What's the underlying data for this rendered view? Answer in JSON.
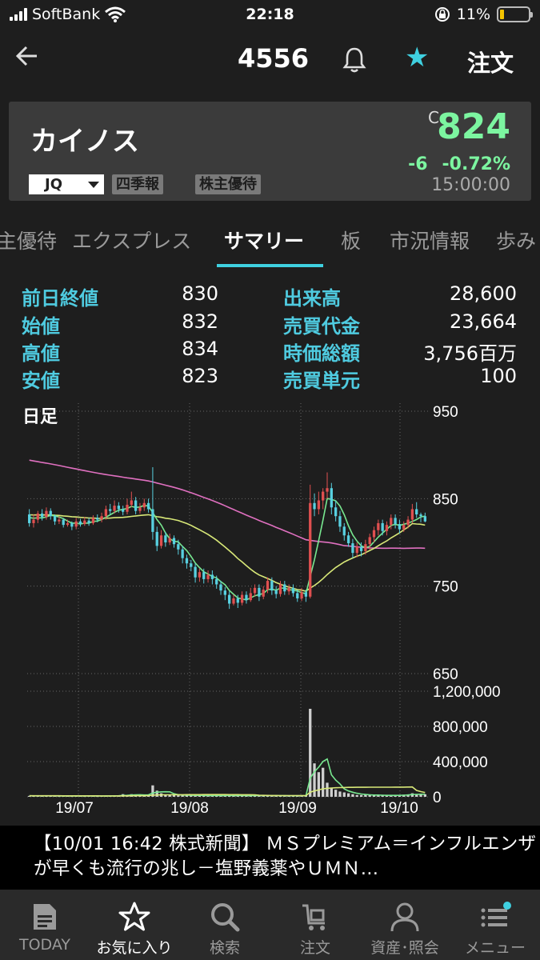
{
  "status": {
    "carrier": "SoftBank",
    "time": "22:18",
    "battery": "11%"
  },
  "nav": {
    "code": "4556",
    "order_label": "注文"
  },
  "quote": {
    "name": "カイノス",
    "price_flag": "C",
    "price": "824",
    "change": "-6",
    "change_pct": "-0.72%",
    "time": "15:00:00",
    "market": "JQ",
    "tags": [
      "四季報",
      "株主優待"
    ]
  },
  "tabs": [
    "主優待",
    "エクスプレス",
    "サマリー",
    "板",
    "市況情報",
    "歩み"
  ],
  "summary": [
    {
      "k1": "前日終値",
      "v1": "830",
      "k2": "出来高",
      "v2": "28,600"
    },
    {
      "k1": "始値",
      "v1": "832",
      "k2": "売買代金",
      "v2": "23,664"
    },
    {
      "k1": "高値",
      "v1": "834",
      "k2": "時価総額",
      "v2": "3,756百万"
    },
    {
      "k1": "安値",
      "v1": "823",
      "k2": "売買単元",
      "v2": "100"
    }
  ],
  "chart_data": {
    "type": "candlestick",
    "label": "日足",
    "price_axis": {
      "ticks": [
        "950",
        "850",
        "750",
        "650"
      ],
      "range": [
        650,
        950
      ]
    },
    "volume_axis": {
      "ticks": [
        "1,200,000",
        "800,000",
        "400,000",
        "0"
      ],
      "range": [
        0,
        1200000
      ]
    },
    "x_labels": [
      "19/07",
      "19/08",
      "19/09",
      "19/10"
    ],
    "candles": [
      [
        832,
        822,
        838,
        818
      ],
      [
        822,
        826,
        832,
        817
      ],
      [
        826,
        833,
        836,
        822
      ],
      [
        833,
        829,
        838,
        825
      ],
      [
        829,
        836,
        840,
        826
      ],
      [
        836,
        830,
        839,
        826
      ],
      [
        830,
        824,
        832,
        820
      ],
      [
        824,
        826,
        830,
        821
      ],
      [
        826,
        820,
        828,
        817
      ],
      [
        820,
        822,
        826,
        818
      ],
      [
        822,
        818,
        824,
        814
      ],
      [
        818,
        824,
        828,
        815
      ],
      [
        824,
        821,
        827,
        818
      ],
      [
        821,
        825,
        829,
        819
      ],
      [
        825,
        822,
        828,
        819
      ],
      [
        822,
        828,
        831,
        820
      ],
      [
        828,
        826,
        832,
        823
      ],
      [
        826,
        830,
        834,
        823
      ],
      [
        830,
        838,
        842,
        826
      ],
      [
        838,
        836,
        844,
        832
      ],
      [
        836,
        842,
        848,
        833
      ],
      [
        842,
        838,
        846,
        834
      ],
      [
        838,
        835,
        842,
        831
      ],
      [
        835,
        843,
        850,
        832
      ],
      [
        843,
        848,
        858,
        840
      ],
      [
        848,
        836,
        852,
        832
      ],
      [
        836,
        840,
        845,
        833
      ],
      [
        840,
        845,
        850,
        836
      ],
      [
        845,
        838,
        850,
        834
      ],
      [
        838,
        812,
        886,
        803
      ],
      [
        812,
        796,
        818,
        790
      ],
      [
        796,
        808,
        814,
        793
      ],
      [
        808,
        800,
        812,
        795
      ],
      [
        800,
        805,
        810,
        797
      ],
      [
        805,
        798,
        808,
        794
      ],
      [
        798,
        792,
        803,
        786
      ],
      [
        792,
        782,
        796,
        776
      ],
      [
        782,
        776,
        786,
        770
      ],
      [
        776,
        772,
        780,
        767
      ],
      [
        772,
        760,
        776,
        754
      ],
      [
        760,
        766,
        770,
        755
      ],
      [
        766,
        758,
        770,
        753
      ],
      [
        758,
        763,
        768,
        754
      ],
      [
        763,
        758,
        768,
        752
      ],
      [
        758,
        752,
        762,
        747
      ],
      [
        752,
        745,
        756,
        740
      ],
      [
        745,
        740,
        749,
        734
      ],
      [
        740,
        730,
        744,
        724
      ],
      [
        730,
        736,
        740,
        728
      ],
      [
        736,
        731,
        740,
        725
      ],
      [
        731,
        740,
        744,
        728
      ],
      [
        740,
        734,
        744,
        730
      ],
      [
        734,
        742,
        748,
        732
      ],
      [
        742,
        748,
        752,
        738
      ],
      [
        748,
        738,
        752,
        733
      ],
      [
        738,
        746,
        750,
        735
      ],
      [
        746,
        756,
        760,
        742
      ],
      [
        756,
        745,
        760,
        740
      ],
      [
        745,
        741,
        750,
        736
      ],
      [
        741,
        752,
        756,
        738
      ],
      [
        752,
        744,
        756,
        740
      ],
      [
        744,
        748,
        752,
        740
      ],
      [
        748,
        742,
        752,
        738
      ],
      [
        742,
        736,
        746,
        732
      ],
      [
        736,
        743,
        748,
        733
      ],
      [
        743,
        738,
        746,
        732
      ],
      [
        738,
        845,
        866,
        736
      ],
      [
        845,
        838,
        856,
        830
      ],
      [
        838,
        848,
        858,
        832
      ],
      [
        848,
        858,
        862,
        838
      ],
      [
        858,
        862,
        880,
        850
      ],
      [
        862,
        840,
        868,
        832
      ],
      [
        840,
        830,
        848,
        824
      ],
      [
        830,
        818,
        836,
        812
      ],
      [
        818,
        808,
        822,
        802
      ],
      [
        808,
        799,
        812,
        795
      ],
      [
        799,
        788,
        804,
        782
      ],
      [
        788,
        795,
        800,
        783
      ],
      [
        795,
        790,
        800,
        784
      ],
      [
        790,
        798,
        803,
        786
      ],
      [
        798,
        806,
        810,
        792
      ],
      [
        806,
        814,
        818,
        800
      ],
      [
        814,
        822,
        826,
        808
      ],
      [
        822,
        813,
        826,
        808
      ],
      [
        813,
        820,
        824,
        808
      ],
      [
        820,
        828,
        832,
        815
      ],
      [
        828,
        821,
        832,
        816
      ],
      [
        821,
        815,
        826,
        810
      ],
      [
        815,
        820,
        824,
        812
      ],
      [
        820,
        826,
        830,
        816
      ],
      [
        826,
        838,
        844,
        822
      ],
      [
        838,
        832,
        846,
        828
      ],
      [
        832,
        830,
        834,
        823
      ],
      [
        830,
        824,
        834,
        823
      ]
    ],
    "volumes": [
      10000,
      10000,
      12000,
      10000,
      12000,
      10000,
      10000,
      8000,
      10000,
      10000,
      8000,
      10000,
      10000,
      8000,
      10000,
      10000,
      8000,
      10000,
      12000,
      10000,
      14000,
      12000,
      30000,
      14000,
      30000,
      24000,
      20000,
      18000,
      22000,
      130000,
      70000,
      40000,
      24000,
      20000,
      18000,
      16000,
      20000,
      18000,
      16000,
      14000,
      14000,
      14000,
      12000,
      14000,
      12000,
      14000,
      16000,
      14000,
      12000,
      14000,
      12000,
      14000,
      12000,
      16000,
      14000,
      12000,
      14000,
      12000,
      14000,
      12000,
      12000,
      10000,
      12000,
      14000,
      12000,
      14000,
      1000000,
      380000,
      280000,
      330000,
      160000,
      100000,
      80000,
      60000,
      50000,
      40000,
      30000,
      20000,
      20000,
      24000,
      20000,
      16000,
      18000,
      14000,
      16000,
      18000,
      14000,
      20000,
      24000,
      28000,
      40000,
      24000,
      30000,
      28600
    ]
  }
}
